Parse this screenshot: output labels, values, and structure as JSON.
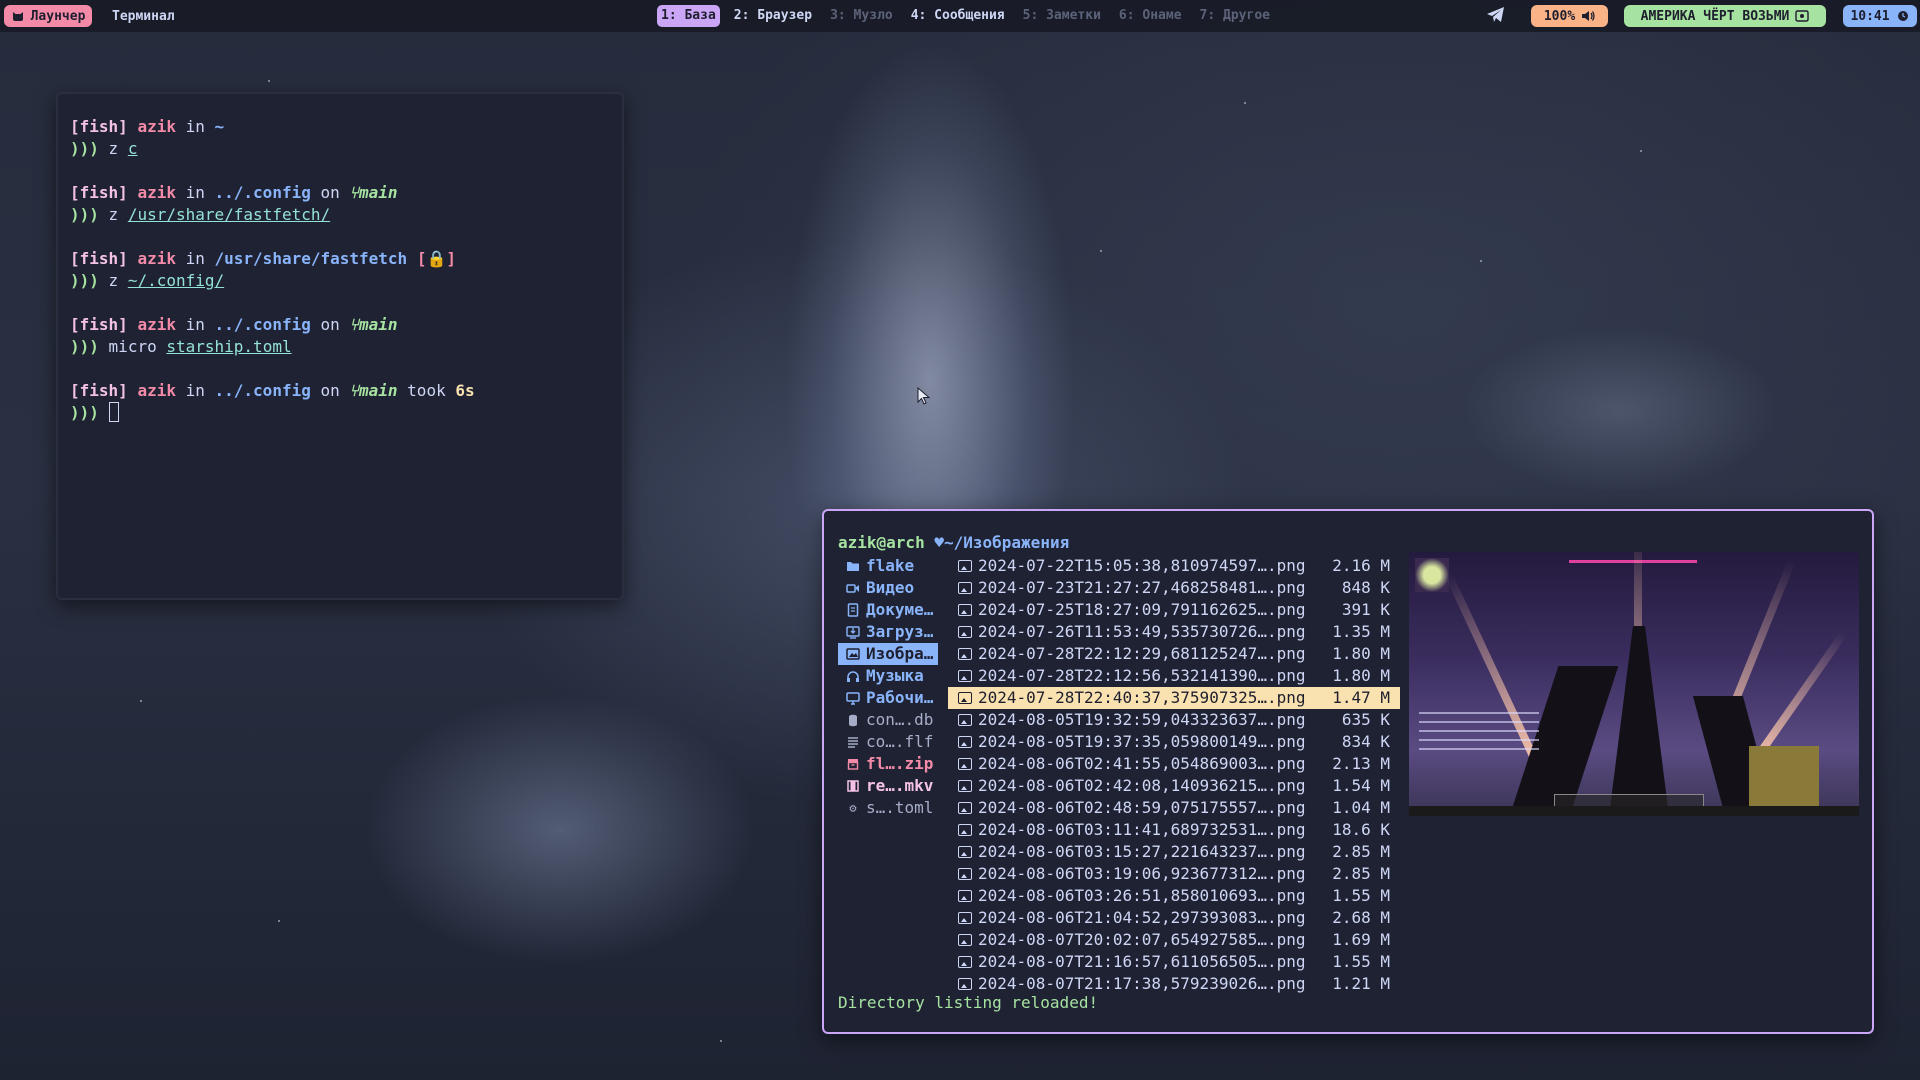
{
  "topbar": {
    "launcher_label": "Лаунчер",
    "app_title": "Терминал",
    "workspaces": [
      {
        "label": "1: База",
        "state": "active"
      },
      {
        "label": "2: Браузер",
        "state": "normal"
      },
      {
        "label": "3: Музло",
        "state": "dim"
      },
      {
        "label": "4: Сообщения",
        "state": "normal"
      },
      {
        "label": "5: Заметки",
        "state": "dim"
      },
      {
        "label": "6: Онаме",
        "state": "dim"
      },
      {
        "label": "7: Другое",
        "state": "dim"
      }
    ],
    "volume": "100%",
    "song": "АМЕРИКА ЧЁРТ ВОЗЬМИ",
    "clock": "10:41",
    "colors": {
      "launcher": "#f38ba8",
      "volume": "#fab387",
      "song": "#a6e3a1",
      "clock": "#89b4fa",
      "active_ws": "#cba6f7"
    }
  },
  "terminal": {
    "shell": "[fish]",
    "user": "azik",
    "prompt": ")))",
    "blocks": [
      {
        "dir": "~",
        "branch": "",
        "cmd": "z",
        "arg": "c"
      },
      {
        "dir": "../.config",
        "branch": "main",
        "cmd": "z",
        "arg": "/usr/share/fastfetch/"
      },
      {
        "dir": "/usr/share/fastfetch",
        "lock": "[🔒]",
        "cmd": "z",
        "arg": "~/.config/"
      },
      {
        "dir": "../.config",
        "branch": "main",
        "cmd": "micro",
        "arg": "starship.toml"
      },
      {
        "dir": "../.config",
        "branch": "main",
        "took": "6s"
      }
    ],
    "in_word": "in",
    "on_word": "on",
    "took_word": "took"
  },
  "file_manager": {
    "host": "azik@arch",
    "path": "~/Изображения",
    "sidebar": [
      {
        "label": "flake",
        "icon": "folder-icon",
        "kind": "dir"
      },
      {
        "label": "Видео",
        "icon": "video-icon",
        "kind": "dir"
      },
      {
        "label": "Докуме…",
        "icon": "document-icon",
        "kind": "dir"
      },
      {
        "label": "Загруз…",
        "icon": "download-icon",
        "kind": "dir"
      },
      {
        "label": "Изобра…",
        "icon": "image-icon",
        "kind": "dir",
        "selected": true
      },
      {
        "label": "Музыка",
        "icon": "headphones-icon",
        "kind": "dir"
      },
      {
        "label": "Рабочи…",
        "icon": "desktop-icon",
        "kind": "dir"
      },
      {
        "label": "con….db",
        "icon": "database-icon",
        "kind": "file"
      },
      {
        "label": "co….flf",
        "icon": "text-file-icon",
        "kind": "file"
      },
      {
        "label": "fl….zip",
        "icon": "archive-icon",
        "kind": "zip"
      },
      {
        "label": "re….mkv",
        "icon": "film-icon",
        "kind": "mkv"
      },
      {
        "label": "s….toml",
        "icon": "gear-icon",
        "kind": "file"
      }
    ],
    "files": [
      {
        "name": "2024-07-22T15:05:38,810974597….png",
        "size": "2.16 M"
      },
      {
        "name": "2024-07-23T21:27:27,468258481….png",
        "size": "848 K"
      },
      {
        "name": "2024-07-25T18:27:09,791162625….png",
        "size": "391 K"
      },
      {
        "name": "2024-07-26T11:53:49,535730726….png",
        "size": "1.35 M"
      },
      {
        "name": "2024-07-28T22:12:29,681125247….png",
        "size": "1.80 M"
      },
      {
        "name": "2024-07-28T22:12:56,532141390….png",
        "size": "1.80 M"
      },
      {
        "name": "2024-07-28T22:40:37,375907325….png",
        "size": "1.47 M",
        "highlighted": true
      },
      {
        "name": "2024-08-05T19:32:59,043323637….png",
        "size": "635 K"
      },
      {
        "name": "2024-08-05T19:37:35,059800149….png",
        "size": "834 K"
      },
      {
        "name": "2024-08-06T02:41:55,054869003….png",
        "size": "2.13 M"
      },
      {
        "name": "2024-08-06T02:42:08,140936215….png",
        "size": "1.54 M"
      },
      {
        "name": "2024-08-06T02:48:59,075175557….png",
        "size": "1.04 M"
      },
      {
        "name": "2024-08-06T03:11:41,689732531….png",
        "size": "18.6 K"
      },
      {
        "name": "2024-08-06T03:15:27,221643237….png",
        "size": "2.85 M"
      },
      {
        "name": "2024-08-06T03:19:06,923677312….png",
        "size": "2.85 M"
      },
      {
        "name": "2024-08-06T03:26:51,858010693….png",
        "size": "1.55 M"
      },
      {
        "name": "2024-08-06T21:04:52,297393083….png",
        "size": "2.68 M"
      },
      {
        "name": "2024-08-07T20:02:07,654927585….png",
        "size": "1.69 M"
      },
      {
        "name": "2024-08-07T21:16:57,611056505….png",
        "size": "1.55 M"
      },
      {
        "name": "2024-08-07T21:17:38,579239026….png",
        "size": "1.21 M"
      }
    ],
    "status": "Directory listing reloaded!",
    "colors": {
      "border": "#cba6f7",
      "highlight": "#f9e2af",
      "selected": "#89b4fa"
    }
  }
}
